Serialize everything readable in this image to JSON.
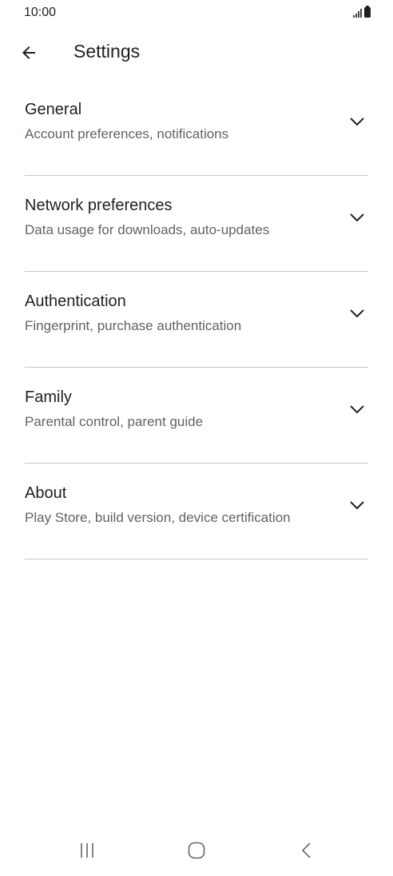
{
  "status_bar": {
    "time": "10:00"
  },
  "app_bar": {
    "title": "Settings",
    "back_icon": "arrow-back-icon"
  },
  "sections": [
    {
      "title": "General",
      "subtitle": "Account preferences, notifications"
    },
    {
      "title": "Network preferences",
      "subtitle": "Data usage for downloads, auto-updates"
    },
    {
      "title": "Authentication",
      "subtitle": "Fingerprint, purchase authentication"
    },
    {
      "title": "Family",
      "subtitle": "Parental control, parent guide"
    },
    {
      "title": "About",
      "subtitle": "Play Store, build version, device certification"
    }
  ],
  "nav_bar": {
    "icons": [
      "recent-apps-icon",
      "home-icon",
      "back-icon"
    ]
  },
  "colors": {
    "text_primary": "#202124",
    "text_secondary": "#5f6368",
    "divider": "#c7c7c7",
    "background": "#ffffff"
  }
}
